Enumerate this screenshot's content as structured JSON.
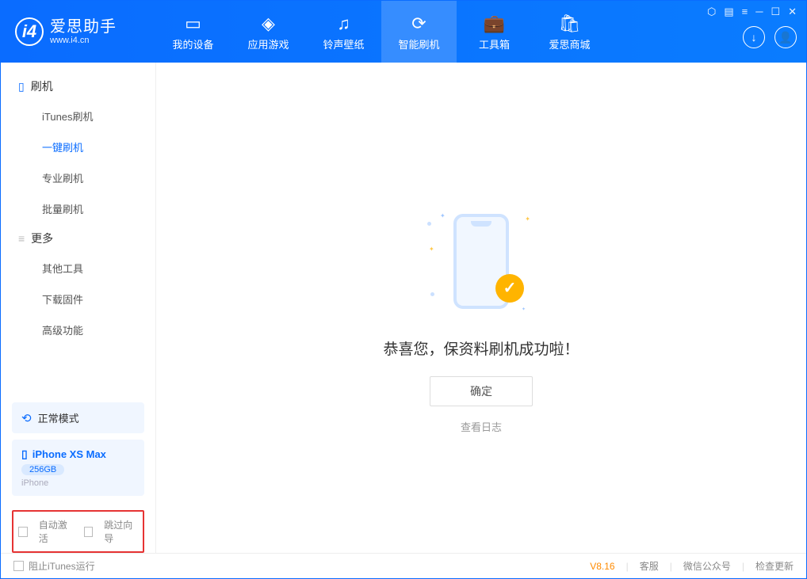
{
  "app": {
    "name": "爱思助手",
    "url": "www.i4.cn"
  },
  "nav": {
    "items": [
      {
        "label": "我的设备"
      },
      {
        "label": "应用游戏"
      },
      {
        "label": "铃声壁纸"
      },
      {
        "label": "智能刷机"
      },
      {
        "label": "工具箱"
      },
      {
        "label": "爱思商城"
      }
    ],
    "active_index": 3
  },
  "sidebar": {
    "section1": {
      "title": "刷机",
      "items": [
        "iTunes刷机",
        "一键刷机",
        "专业刷机",
        "批量刷机"
      ],
      "active_index": 1
    },
    "section2": {
      "title": "更多",
      "items": [
        "其他工具",
        "下载固件",
        "高级功能"
      ]
    },
    "mode": "正常模式",
    "device": {
      "name": "iPhone XS Max",
      "storage": "256GB",
      "type": "iPhone"
    },
    "checkboxes": {
      "auto_activate": "自动激活",
      "skip_guide": "跳过向导"
    }
  },
  "content": {
    "success_text": "恭喜您，保资料刷机成功啦！",
    "ok_button": "确定",
    "log_link": "查看日志"
  },
  "footer": {
    "block_itunes": "阻止iTunes运行",
    "version": "V8.16",
    "links": [
      "客服",
      "微信公众号",
      "检查更新"
    ]
  }
}
